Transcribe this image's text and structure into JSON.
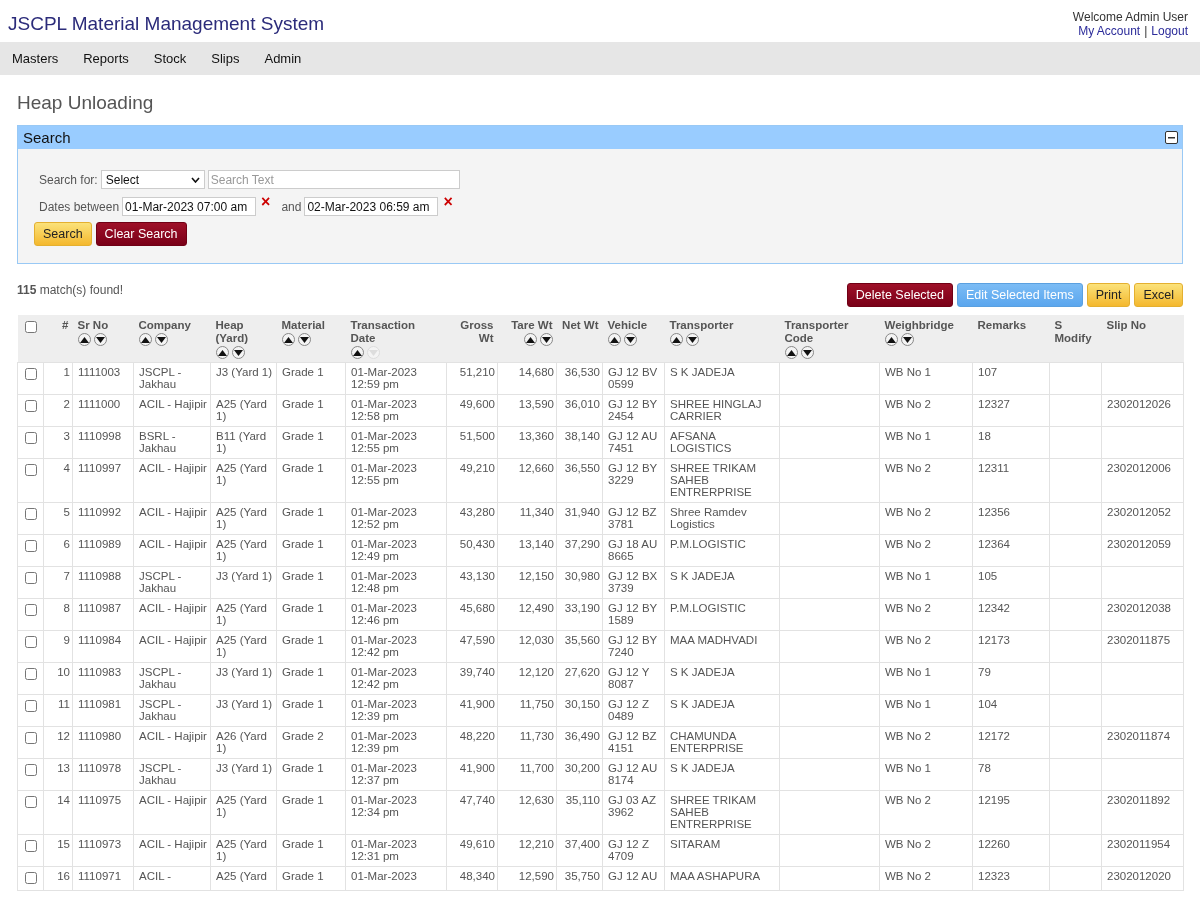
{
  "app_title": "JSCPL Material Management System",
  "user": {
    "welcome": "Welcome Admin User",
    "links": [
      "My Account",
      "Logout"
    ],
    "separator": "|"
  },
  "menu": [
    "Masters",
    "Reports",
    "Stock",
    "Slips",
    "Admin"
  ],
  "page_title": "Heap Unloading",
  "search_panel": {
    "title": "Search",
    "expanded": true,
    "search_for_label": "Search for:",
    "select_value": "Select",
    "search_text_placeholder": "Search Text",
    "dates_label": "Dates between",
    "date_from": "01-Mar-2023 07:00 am",
    "and_label": "and",
    "date_to": "02-Mar-2023 06:59 am",
    "clear_mark": "×",
    "buttons": [
      {
        "label": "Search",
        "kind": "primary"
      },
      {
        "label": "Clear Search",
        "kind": "danger"
      }
    ]
  },
  "results": {
    "count": "115",
    "text": " match(s) found!"
  },
  "actions": [
    {
      "label": "Delete Selected",
      "kind": "danger"
    },
    {
      "label": "Edit Selected Items",
      "kind": "info"
    },
    {
      "label": "Print",
      "kind": "primary"
    },
    {
      "label": "Excel",
      "kind": "primary"
    }
  ],
  "table": {
    "select_all": false,
    "columns": [
      {
        "label": "#",
        "kind": "number",
        "sortable": false
      },
      {
        "label": "Sr No",
        "kind": "text",
        "sortable": true
      },
      {
        "label": "Company",
        "kind": "text",
        "sortable": true
      },
      {
        "label": "Heap (Yard)",
        "kind": "text",
        "sortable": true
      },
      {
        "label": "Material",
        "kind": "text",
        "sortable": true
      },
      {
        "label": "Transaction Date",
        "kind": "text",
        "sortable": true,
        "sorted_desc": true
      },
      {
        "label": "Gross Wt",
        "kind": "number",
        "sortable": false
      },
      {
        "label": "Tare Wt",
        "kind": "number",
        "sortable": true
      },
      {
        "label": "Net Wt",
        "kind": "number",
        "sortable": false
      },
      {
        "label": "Vehicle",
        "kind": "text",
        "sortable": true
      },
      {
        "label": "Transporter",
        "kind": "text",
        "sortable": true
      },
      {
        "label": "Transporter Code",
        "kind": "text",
        "sortable": true
      },
      {
        "label": "Weighbridge",
        "kind": "text",
        "sortable": true
      },
      {
        "label": "Remarks",
        "kind": "text",
        "sortable": false
      },
      {
        "label": "S Modify",
        "kind": "text",
        "sortable": false
      },
      {
        "label": "Slip No",
        "kind": "text",
        "sortable": false
      }
    ],
    "rows": [
      {
        "checked": false,
        "cells": [
          "1",
          "1111003",
          "JSCPL - Jakhau",
          "J3 (Yard 1)",
          "Grade 1",
          "01-Mar-2023 12:59 pm",
          "51,210",
          "14,680",
          "36,530",
          "GJ 12 BV 0599",
          "S K JADEJA",
          "",
          "WB No 1",
          "107",
          "",
          ""
        ]
      },
      {
        "checked": false,
        "cells": [
          "2",
          "1111000",
          "ACIL - Hajipir",
          "A25 (Yard 1)",
          "Grade 1",
          "01-Mar-2023 12:58 pm",
          "49,600",
          "13,590",
          "36,010",
          "GJ 12 BY 2454",
          "SHREE HINGLAJ CARRIER",
          "",
          "WB No 2",
          "12327",
          "",
          "2302012026"
        ]
      },
      {
        "checked": false,
        "cells": [
          "3",
          "1110998",
          "BSRL - Jakhau",
          "B11 (Yard 1)",
          "Grade 1",
          "01-Mar-2023 12:55 pm",
          "51,500",
          "13,360",
          "38,140",
          "GJ 12 AU 7451",
          "AFSANA LOGISTICS",
          "",
          "WB No 1",
          "18",
          "",
          ""
        ]
      },
      {
        "checked": false,
        "cells": [
          "4",
          "1110997",
          "ACIL - Hajipir",
          "A25 (Yard 1)",
          "Grade 1",
          "01-Mar-2023 12:55 pm",
          "49,210",
          "12,660",
          "36,550",
          "GJ 12 BY 3229",
          "SHREE TRIKAM SAHEB ENTRERPRISE",
          "",
          "WB No 2",
          "12311",
          "",
          "2302012006"
        ]
      },
      {
        "checked": false,
        "cells": [
          "5",
          "1110992",
          "ACIL - Hajipir",
          "A25 (Yard 1)",
          "Grade 1",
          "01-Mar-2023 12:52 pm",
          "43,280",
          "11,340",
          "31,940",
          "GJ 12 BZ 3781",
          "Shree Ramdev Logistics",
          "",
          "WB No 2",
          "12356",
          "",
          "2302012052"
        ]
      },
      {
        "checked": false,
        "cells": [
          "6",
          "1110989",
          "ACIL - Hajipir",
          "A25 (Yard 1)",
          "Grade 1",
          "01-Mar-2023 12:49 pm",
          "50,430",
          "13,140",
          "37,290",
          "GJ 18 AU 8665",
          "P.M.LOGISTIC",
          "",
          "WB No 2",
          "12364",
          "",
          "2302012059"
        ]
      },
      {
        "checked": false,
        "cells": [
          "7",
          "1110988",
          "JSCPL - Jakhau",
          "J3 (Yard 1)",
          "Grade 1",
          "01-Mar-2023 12:48 pm",
          "43,130",
          "12,150",
          "30,980",
          "GJ 12 BX 3739",
          "S K JADEJA",
          "",
          "WB No 1",
          "105",
          "",
          ""
        ]
      },
      {
        "checked": false,
        "cells": [
          "8",
          "1110987",
          "ACIL - Hajipir",
          "A25 (Yard 1)",
          "Grade 1",
          "01-Mar-2023 12:46 pm",
          "45,680",
          "12,490",
          "33,190",
          "GJ 12 BY 1589",
          "P.M.LOGISTIC",
          "",
          "WB No 2",
          "12342",
          "",
          "2302012038"
        ]
      },
      {
        "checked": false,
        "cells": [
          "9",
          "1110984",
          "ACIL - Hajipir",
          "A25 (Yard 1)",
          "Grade 1",
          "01-Mar-2023 12:42 pm",
          "47,590",
          "12,030",
          "35,560",
          "GJ 12 BY 7240",
          "MAA MADHVADI",
          "",
          "WB No 2",
          "12173",
          "",
          "2302011875"
        ]
      },
      {
        "checked": false,
        "cells": [
          "10",
          "1110983",
          "JSCPL - Jakhau",
          "J3 (Yard 1)",
          "Grade 1",
          "01-Mar-2023 12:42 pm",
          "39,740",
          "12,120",
          "27,620",
          "GJ 12 Y 8087",
          "S K JADEJA",
          "",
          "WB No 1",
          "79",
          "",
          ""
        ]
      },
      {
        "checked": false,
        "cells": [
          "11",
          "1110981",
          "JSCPL - Jakhau",
          "J3 (Yard 1)",
          "Grade 1",
          "01-Mar-2023 12:39 pm",
          "41,900",
          "11,750",
          "30,150",
          "GJ 12 Z 0489",
          "S K JADEJA",
          "",
          "WB No 1",
          "104",
          "",
          ""
        ]
      },
      {
        "checked": false,
        "cells": [
          "12",
          "1110980",
          "ACIL - Hajipir",
          "A26 (Yard 1)",
          "Grade 2",
          "01-Mar-2023 12:39 pm",
          "48,220",
          "11,730",
          "36,490",
          "GJ 12 BZ 4151",
          "CHAMUNDA ENTERPRISE",
          "",
          "WB No 2",
          "12172",
          "",
          "2302011874"
        ]
      },
      {
        "checked": false,
        "cells": [
          "13",
          "1110978",
          "JSCPL - Jakhau",
          "J3 (Yard 1)",
          "Grade 1",
          "01-Mar-2023 12:37 pm",
          "41,900",
          "11,700",
          "30,200",
          "GJ 12 AU 8174",
          "S K JADEJA",
          "",
          "WB No 1",
          "78",
          "",
          ""
        ]
      },
      {
        "checked": false,
        "cells": [
          "14",
          "1110975",
          "ACIL - Hajipir",
          "A25 (Yard 1)",
          "Grade 1",
          "01-Mar-2023 12:34 pm",
          "47,740",
          "12,630",
          "35,110",
          "GJ 03 AZ 3962",
          "SHREE TRIKAM SAHEB ENTRERPRISE",
          "",
          "WB No 2",
          "12195",
          "",
          "2302011892"
        ]
      },
      {
        "checked": false,
        "cells": [
          "15",
          "1110973",
          "ACIL - Hajipir",
          "A25 (Yard 1)",
          "Grade 1",
          "01-Mar-2023 12:31 pm",
          "49,610",
          "12,210",
          "37,400",
          "GJ 12 Z 4709",
          "SITARAM",
          "",
          "WB No 2",
          "12260",
          "",
          "2302011954"
        ]
      },
      {
        "checked": false,
        "cells": [
          "16",
          "1110971",
          "ACIL -",
          "A25 (Yard",
          "Grade 1",
          "01-Mar-2023",
          "48,340",
          "12,590",
          "35,750",
          "GJ 12 AU",
          "MAA ASHAPURA",
          "",
          "WB No 2",
          "12323",
          "",
          "2302012020"
        ]
      }
    ]
  }
}
